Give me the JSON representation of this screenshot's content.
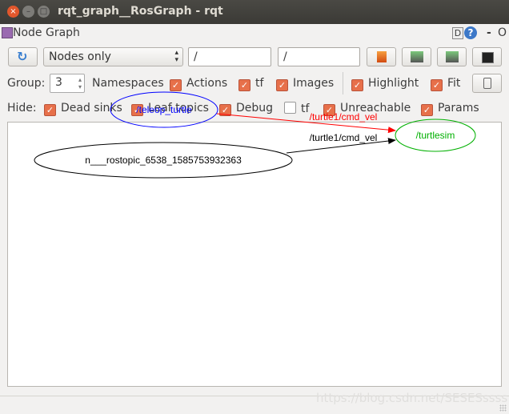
{
  "window": {
    "title": "rqt_graph__RosGraph - rqt"
  },
  "plugin": {
    "title": "Node Graph",
    "help_d": "D",
    "help_q": "?",
    "minimize": "-",
    "close": "O"
  },
  "toolbar": {
    "mode": "Nodes only",
    "filter_nodes": "/",
    "filter_topics": "/"
  },
  "group": {
    "label": "Group:",
    "value": "3",
    "items": [
      {
        "label": "Namespaces",
        "checkbox": false
      },
      {
        "label": "Actions",
        "checked": true
      },
      {
        "label": "tf",
        "checked": true
      },
      {
        "label": "Images",
        "checked": true
      }
    ],
    "highlight": {
      "label": "Highlight",
      "checked": true
    },
    "fit": {
      "label": "Fit",
      "checked": true
    }
  },
  "hide": {
    "label": "Hide:",
    "items": [
      {
        "label": "Dead sinks",
        "checked": true
      },
      {
        "label": "Leaf topics",
        "checked": true
      },
      {
        "label": "Debug",
        "checked": true
      },
      {
        "label": "tf",
        "checked": false
      },
      {
        "label": "Unreachable",
        "checked": true
      },
      {
        "label": "Params",
        "checked": true
      }
    ]
  },
  "graph": {
    "nodes": [
      {
        "name": "/teleop_turtle",
        "color": "#0000ff"
      },
      {
        "name": "/turtlesim",
        "color": "#00b000"
      },
      {
        "name": "n___rostopic_6538_1585753932363",
        "color": "#000000"
      }
    ],
    "edges": [
      {
        "label": "/turtle1/cmd_vel",
        "from": "/teleop_turtle",
        "to": "/turtlesim",
        "color": "#ff0000"
      },
      {
        "label": "/turtle1/cmd_vel",
        "from": "n___rostopic_6538_1585753932363",
        "to": "/turtlesim",
        "color": "#000000"
      }
    ]
  },
  "watermark": "https://blog.csdn.net/SESESssss"
}
